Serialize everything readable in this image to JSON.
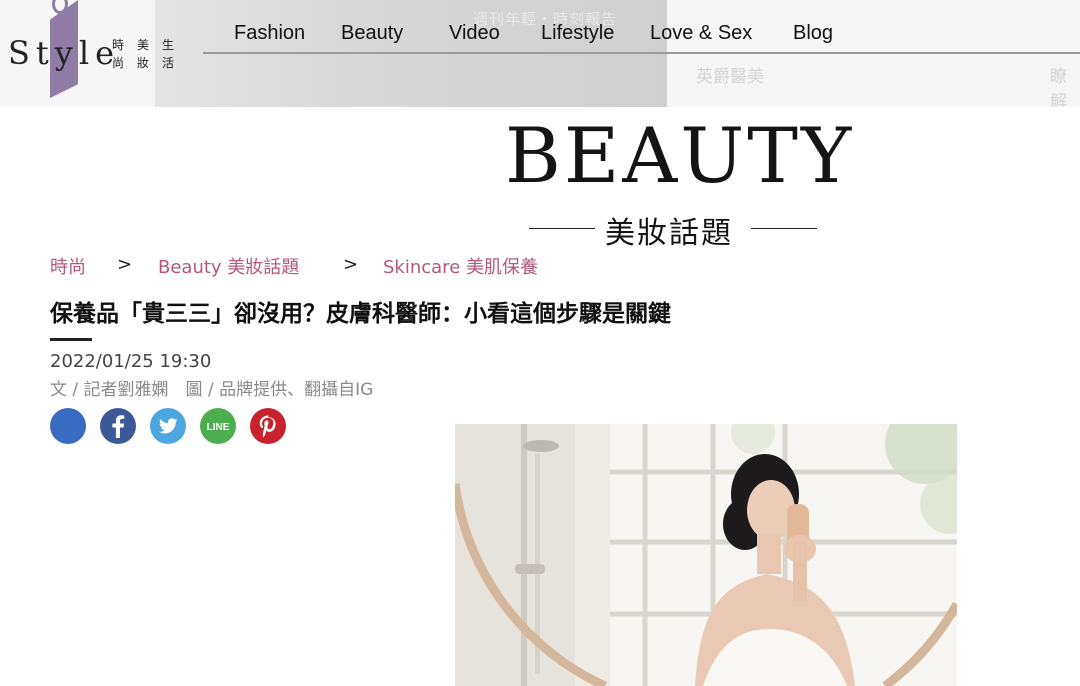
{
  "header": {
    "banner_text": "週刊年輕・時刻報告",
    "ghost_text_1": "英爵醫美",
    "ghost_text_2": "瞭解"
  },
  "logo": {
    "text": "Style",
    "tagline": [
      "時",
      "美",
      "生",
      "尚",
      "妝",
      "活"
    ]
  },
  "nav": {
    "items": [
      "Fashion",
      "Beauty",
      "Video",
      "Lifestyle",
      "Love & Sex",
      "Blog"
    ]
  },
  "section": {
    "title": "BEAUTY",
    "subtitle": "美妝話題"
  },
  "breadcrumb": {
    "items": [
      "時尚",
      "Beauty 美妝話題",
      "Skincare 美肌保養"
    ],
    "separator": ">"
  },
  "article": {
    "title": "保養品「貴三三」卻沒用？皮膚科醫師：小看這個步驟是關鍵",
    "date": "2022/01/25 19:30",
    "byline": "文 / 記者劉雅嫻　圖 / 品牌提供、翻攝自IG"
  },
  "share": {
    "buttons": [
      {
        "name": "share-blank",
        "icon": "circle",
        "color": "#3a6bc3"
      },
      {
        "name": "facebook",
        "icon": "facebook-icon",
        "color": "#3b5998"
      },
      {
        "name": "twitter",
        "icon": "twitter-icon",
        "color": "#4da7de"
      },
      {
        "name": "line",
        "icon": "line-icon",
        "color": "#4cae4f",
        "label": "LINE"
      },
      {
        "name": "pinterest",
        "icon": "pinterest-icon",
        "color": "#c8232c"
      }
    ]
  },
  "colors": {
    "accent_pink": "#b5577e",
    "logo_purple": "#8e7ba6"
  }
}
